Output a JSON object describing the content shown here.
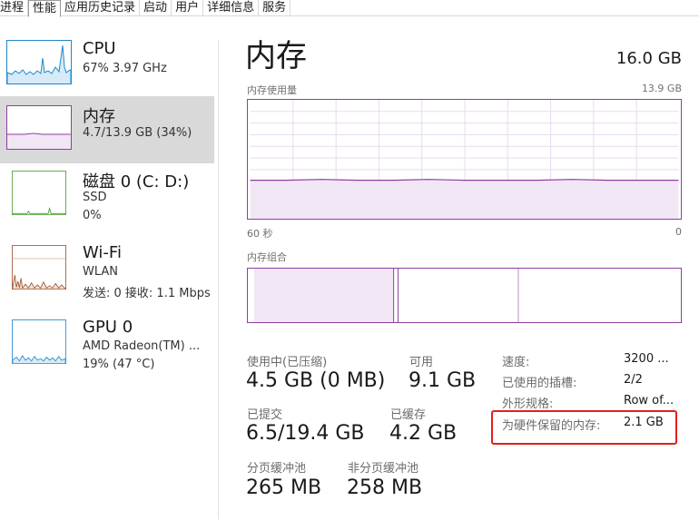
{
  "tabs": [
    "进程",
    "性能",
    "应用历史记录",
    "启动",
    "用户",
    "详细信息",
    "服务"
  ],
  "active_tab": "性能",
  "sidebar": {
    "items": [
      {
        "title": "CPU",
        "line1": "67% 3.97 GHz",
        "line2": ""
      },
      {
        "title": "内存",
        "line1": "4.7/13.9 GB (34%)",
        "line2": ""
      },
      {
        "title": "磁盘 0 (C: D:)",
        "line1": "SSD",
        "line2": "0%"
      },
      {
        "title": "Wi-Fi",
        "line1": "WLAN",
        "line2": "发送: 0 接收: 1.1 Mbps"
      },
      {
        "title": "GPU 0",
        "line1": "AMD Radeon(TM) ...",
        "line2": "19% (47 °C)"
      }
    ],
    "colors": {
      "cpu": "#1f88c9",
      "memory": "#8e3ea1",
      "disk": "#4a9e32",
      "wifi": "#a0522d",
      "gpu": "#1f88c9"
    }
  },
  "main": {
    "title": "内存",
    "total": "16.0 GB",
    "usage_label": "内存使用量",
    "usage_max": "13.9 GB",
    "axis_left": "60 秒",
    "axis_right": "0",
    "composition_label": "内存组合",
    "usage_fraction": 0.34,
    "stats": {
      "in_use_label": "使用中(已压缩)",
      "in_use_value": "4.5 GB (0 MB)",
      "available_label": "可用",
      "available_value": "9.1 GB",
      "committed_label": "已提交",
      "committed_value": "6.5/19.4 GB",
      "cached_label": "已缓存",
      "cached_value": "4.2 GB",
      "paged_label": "分页缓冲池",
      "paged_value": "265 MB",
      "nonpaged_label": "非分页缓冲池",
      "nonpaged_value": "258 MB"
    },
    "details": [
      {
        "label": "速度:",
        "value": "3200 ..."
      },
      {
        "label": "已使用的插槽:",
        "value": "2/2"
      },
      {
        "label": "外形规格:",
        "value": "Row of..."
      },
      {
        "label": "为硬件保留的内存:",
        "value": "2.1 GB"
      }
    ],
    "accent": "#8e3ea1",
    "highlight_color": "#e0201c"
  }
}
